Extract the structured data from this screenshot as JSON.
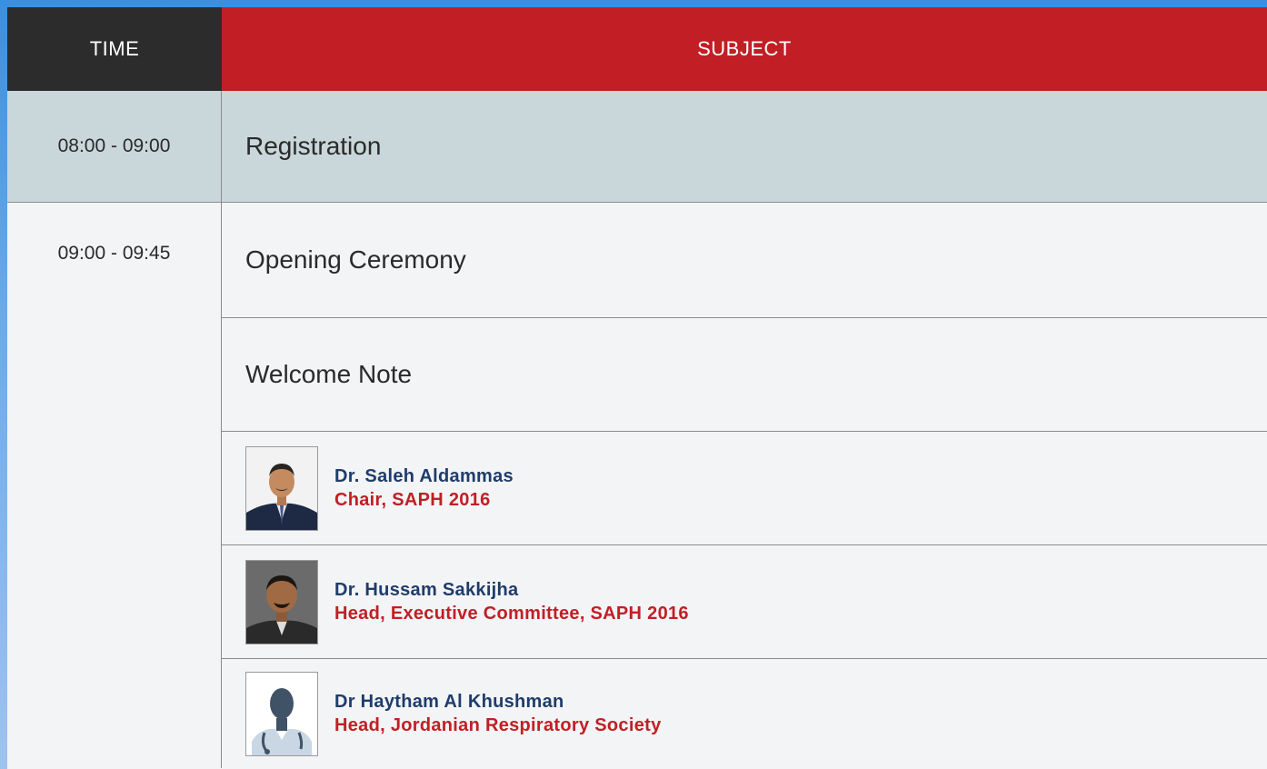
{
  "header": {
    "time_label": "TIME",
    "subject_label": "SUBJECT"
  },
  "colors": {
    "header_time_bg": "#2c2c2c",
    "header_subject_bg": "#c11f25",
    "registration_bg": "#c9d6da",
    "speaker_name": "#1f3c6a",
    "speaker_role": "#c11f25"
  },
  "rows": [
    {
      "time": "08:00 - 09:00",
      "subject": "Registration"
    },
    {
      "time": "09:00 - 09:45",
      "items": [
        {
          "subject": "Opening Ceremony"
        },
        {
          "subject": "Welcome Note"
        },
        {
          "name": "Dr. Saleh Aldammas",
          "role": "Chair, SAPH 2016",
          "photo_icon": "portrait-photo"
        },
        {
          "name": "Dr. Hussam Sakkijha",
          "role": "Head, Executive Committee, SAPH 2016",
          "photo_icon": "portrait-photo"
        },
        {
          "name": "Dr Haytham Al Khushman",
          "role": "Head, Jordanian Respiratory Society",
          "photo_icon": "doctor-placeholder-icon"
        }
      ]
    }
  ]
}
